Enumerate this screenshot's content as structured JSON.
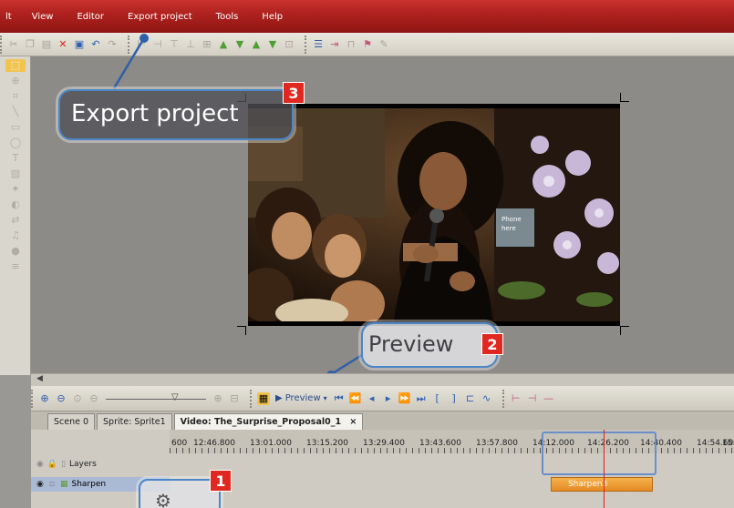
{
  "menu": {
    "items": [
      "lt",
      "View",
      "Editor",
      "Export project",
      "Tools",
      "Help"
    ]
  },
  "callouts": {
    "export": {
      "label": "Export project",
      "number": "3"
    },
    "preview": {
      "label": "Preview",
      "number": "2"
    },
    "layers": {
      "number": "1"
    }
  },
  "transport": {
    "preview_label": "Preview"
  },
  "tabs": [
    {
      "label": "Scene 0"
    },
    {
      "label": "Sprite: Sprite1"
    },
    {
      "label": "Video: The_Surprise_Proposal0_1"
    }
  ],
  "tab_close": "×",
  "timeline": {
    "ticks": [
      "600",
      "12:46.800",
      "13:01.000",
      "13:15.200",
      "13:29.400",
      "13:43.600",
      "13:57.800",
      "14:12.000",
      "14:26.200",
      "14:40.400",
      "14:54.600",
      "15:0"
    ],
    "layers_label": "Layers",
    "track_label": "Sharpen",
    "clip_label": "Sharpen3"
  },
  "photo_text": {
    "sign": "Phone\nhere"
  },
  "colors": {
    "menubar": "#b0221f",
    "accent_blue": "#4c86c6",
    "badge_red": "#e02720",
    "clip_orange": "#f0a040"
  }
}
